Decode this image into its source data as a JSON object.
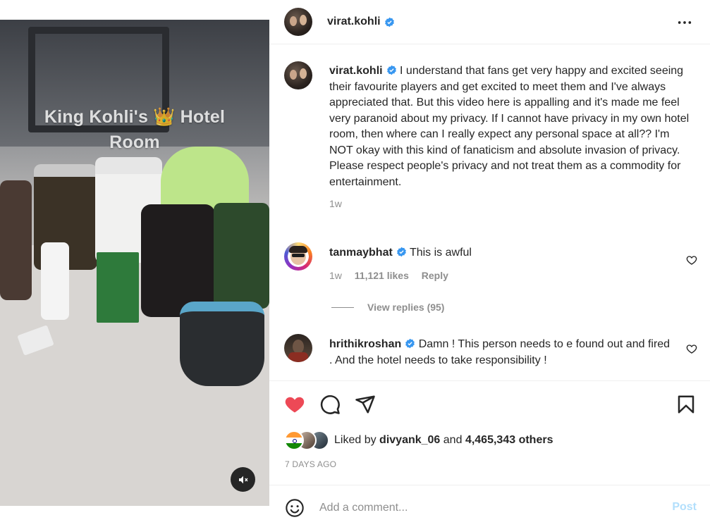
{
  "media": {
    "overlay_line1": "King Kohli's 👑 Hotel",
    "overlay_line2": "Room"
  },
  "post": {
    "author": "virat.kohli",
    "caption_author": "virat.kohli",
    "caption": "I understand that fans get very happy and excited seeing their favourite players and get excited to meet them and I've always appreciated that. But this video here is appalling and it's made me feel very paranoid about my privacy. If I cannot have privacy in my own hotel room, then where can I really expect any personal space at all?? I'm NOT okay with this kind of fanaticism and absolute invasion of privacy. Please respect people's privacy and not treat them as a commodity for entertainment.",
    "caption_age": "1w"
  },
  "comments": [
    {
      "username": "tanmaybhat",
      "text": "This is awful",
      "age": "1w",
      "likes": "11,121 likes",
      "reply": "Reply",
      "view_replies": "View replies (95)"
    },
    {
      "username": "hrithikroshan",
      "text": "Damn ! This person needs to e found out and fired . And the hotel needs to take responsibility !"
    }
  ],
  "likes": {
    "prefix": "Liked by",
    "user": "divyank_06",
    "and": "and",
    "others": "4,465,343 others"
  },
  "date": "7 DAYS AGO",
  "add_comment": {
    "placeholder": "Add a comment...",
    "post_label": "Post"
  },
  "colors": {
    "like_red": "#ed4956",
    "verified_blue": "#3897f0",
    "muted_text": "#8e8e8e",
    "post_disabled": "#b2dffc"
  },
  "icons": {
    "more": "more-horizontal-icon",
    "like": "heart-filled-icon",
    "comment": "comment-icon",
    "share": "paper-plane-icon",
    "save": "bookmark-icon",
    "emoji": "emoji-icon",
    "mute": "speaker-muted-icon"
  }
}
